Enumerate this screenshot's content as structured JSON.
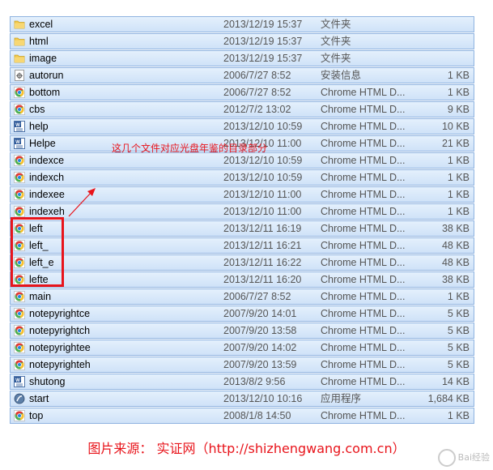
{
  "files": [
    {
      "name": "excel",
      "date": "2013/12/19 15:37",
      "type": "文件夹",
      "size": "",
      "icon": "folder-icon"
    },
    {
      "name": "html",
      "date": "2013/12/19 15:37",
      "type": "文件夹",
      "size": "",
      "icon": "folder-icon"
    },
    {
      "name": "image",
      "date": "2013/12/19 15:37",
      "type": "文件夹",
      "size": "",
      "icon": "folder-icon"
    },
    {
      "name": "autorun",
      "date": "2006/7/27 8:52",
      "type": "安装信息",
      "size": "1 KB",
      "icon": "settings-file-icon"
    },
    {
      "name": "bottom",
      "date": "2006/7/27 8:52",
      "type": "Chrome HTML D...",
      "size": "1 KB",
      "icon": "chrome-icon"
    },
    {
      "name": "cbs",
      "date": "2012/7/2 13:02",
      "type": "Chrome HTML D...",
      "size": "9 KB",
      "icon": "chrome-icon"
    },
    {
      "name": "help",
      "date": "2013/12/10 10:59",
      "type": "Chrome HTML D...",
      "size": "10 KB",
      "icon": "word-doc-icon"
    },
    {
      "name": "Helpe",
      "date": "2013/12/10 11:00",
      "type": "Chrome HTML D...",
      "size": "21 KB",
      "icon": "word-doc-icon"
    },
    {
      "name": "indexce",
      "date": "2013/12/10 10:59",
      "type": "Chrome HTML D...",
      "size": "1 KB",
      "icon": "chrome-icon"
    },
    {
      "name": "indexch",
      "date": "2013/12/10 10:59",
      "type": "Chrome HTML D...",
      "size": "1 KB",
      "icon": "chrome-icon"
    },
    {
      "name": "indexee",
      "date": "2013/12/10 11:00",
      "type": "Chrome HTML D...",
      "size": "1 KB",
      "icon": "chrome-icon"
    },
    {
      "name": "indexeh",
      "date": "2013/12/10 11:00",
      "type": "Chrome HTML D...",
      "size": "1 KB",
      "icon": "chrome-icon"
    },
    {
      "name": "left",
      "date": "2013/12/11 16:19",
      "type": "Chrome HTML D...",
      "size": "38 KB",
      "icon": "chrome-icon"
    },
    {
      "name": "left_",
      "date": "2013/12/11 16:21",
      "type": "Chrome HTML D...",
      "size": "48 KB",
      "icon": "chrome-icon"
    },
    {
      "name": "left_e",
      "date": "2013/12/11 16:22",
      "type": "Chrome HTML D...",
      "size": "48 KB",
      "icon": "chrome-icon"
    },
    {
      "name": "lefte",
      "date": "2013/12/11 16:20",
      "type": "Chrome HTML D...",
      "size": "38 KB",
      "icon": "chrome-icon"
    },
    {
      "name": "main",
      "date": "2006/7/27 8:52",
      "type": "Chrome HTML D...",
      "size": "1 KB",
      "icon": "chrome-icon"
    },
    {
      "name": "notepyrightce",
      "date": "2007/9/20 14:01",
      "type": "Chrome HTML D...",
      "size": "5 KB",
      "icon": "chrome-icon"
    },
    {
      "name": "notepyrightch",
      "date": "2007/9/20 13:58",
      "type": "Chrome HTML D...",
      "size": "5 KB",
      "icon": "chrome-icon"
    },
    {
      "name": "notepyrightee",
      "date": "2007/9/20 14:02",
      "type": "Chrome HTML D...",
      "size": "5 KB",
      "icon": "chrome-icon"
    },
    {
      "name": "notepyrighteh",
      "date": "2007/9/20 13:59",
      "type": "Chrome HTML D...",
      "size": "5 KB",
      "icon": "chrome-icon"
    },
    {
      "name": "shutong",
      "date": "2013/8/2 9:56",
      "type": "Chrome HTML D...",
      "size": "14 KB",
      "icon": "word-doc-icon"
    },
    {
      "name": "start",
      "date": "2013/12/10 10:16",
      "type": "应用程序",
      "size": "1,684 KB",
      "icon": "app-exe-icon"
    },
    {
      "name": "top",
      "date": "2008/1/8 14:50",
      "type": "Chrome HTML D...",
      "size": "1 KB",
      "icon": "chrome-icon"
    }
  ],
  "annotation": {
    "text": "这几个文件对应光盘年鉴的目录部分",
    "color": "#e8141b"
  },
  "footer": {
    "text": "图片来源： 实证网（http://shizhengwang.com.cn）"
  },
  "watermark": {
    "text": "Bai经验"
  },
  "colors": {
    "row_bg": "#d8e8f9",
    "row_border": "#8fb3e0",
    "accent_red": "#e8141b"
  }
}
